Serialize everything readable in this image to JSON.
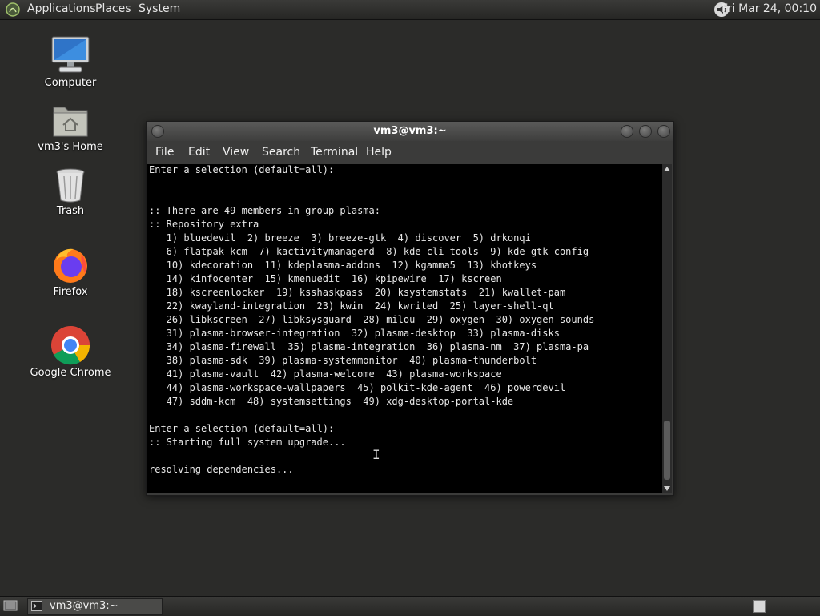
{
  "top_panel": {
    "menus": [
      "Applications",
      "Places",
      "System"
    ],
    "clock": "Fri Mar 24, 00:10",
    "icons": {
      "menu": "mate-logo-icon",
      "volume": "volume-icon"
    }
  },
  "desktop": {
    "icons": [
      {
        "label": "Computer",
        "icon": "computer-icon"
      },
      {
        "label": "vm3's Home",
        "icon": "home-folder-icon"
      },
      {
        "label": "Trash",
        "icon": "trash-icon"
      },
      {
        "label": "Firefox",
        "icon": "firefox-icon"
      },
      {
        "label": "Google Chrome",
        "icon": "chrome-icon"
      }
    ]
  },
  "window": {
    "title": "vm3@vm3:~",
    "menu": [
      "File",
      "Edit",
      "View",
      "Search",
      "Terminal",
      "Help"
    ],
    "terminal_lines": [
      "Enter a selection (default=all):",
      "",
      "",
      ":: There are 49 members in group plasma:",
      ":: Repository extra",
      "   1) bluedevil  2) breeze  3) breeze-gtk  4) discover  5) drkonqi",
      "   6) flatpak-kcm  7) kactivitymanagerd  8) kde-cli-tools  9) kde-gtk-config",
      "   10) kdecoration  11) kdeplasma-addons  12) kgamma5  13) khotkeys",
      "   14) kinfocenter  15) kmenuedit  16) kpipewire  17) kscreen",
      "   18) kscreenlocker  19) ksshaskpass  20) ksystemstats  21) kwallet-pam",
      "   22) kwayland-integration  23) kwin  24) kwrited  25) layer-shell-qt",
      "   26) libkscreen  27) libksysguard  28) milou  29) oxygen  30) oxygen-sounds",
      "   31) plasma-browser-integration  32) plasma-desktop  33) plasma-disks",
      "   34) plasma-firewall  35) plasma-integration  36) plasma-nm  37) plasma-pa",
      "   38) plasma-sdk  39) plasma-systemmonitor  40) plasma-thunderbolt",
      "   41) plasma-vault  42) plasma-welcome  43) plasma-workspace",
      "   44) plasma-workspace-wallpapers  45) polkit-kde-agent  46) powerdevil",
      "   47) sddm-kcm  48) systemsettings  49) xdg-desktop-portal-kde",
      "",
      "Enter a selection (default=all):",
      ":: Starting full system upgrade...",
      "",
      "resolving dependencies..."
    ]
  },
  "taskbar": {
    "task_label": "vm3@vm3:~",
    "icons": {
      "show_desktop": "show-desktop-icon",
      "task": "terminal-icon",
      "workspace": "workspace-switcher-icon"
    }
  }
}
